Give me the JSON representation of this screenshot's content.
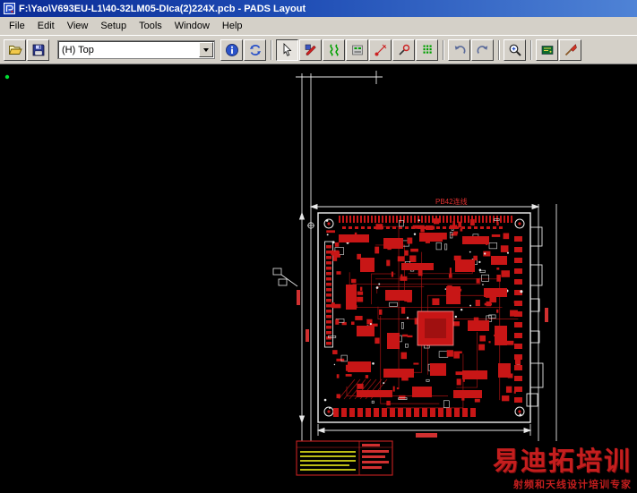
{
  "window": {
    "title": "F:\\Yao\\V693EU-L1\\40-32LM05-DIca(2)224X.pcb - PADS Layout"
  },
  "menu": {
    "items": [
      {
        "label": "File"
      },
      {
        "label": "Edit"
      },
      {
        "label": "View"
      },
      {
        "label": "Setup"
      },
      {
        "label": "Tools"
      },
      {
        "label": "Window"
      },
      {
        "label": "Help"
      }
    ]
  },
  "toolbar": {
    "layer_select": {
      "value": "(H) Top"
    },
    "buttons": [
      {
        "name": "open",
        "icon": "open-folder-icon"
      },
      {
        "name": "save",
        "icon": "floppy-disk-icon"
      },
      {
        "name": "object-info",
        "icon": "info-icon"
      },
      {
        "name": "redraw",
        "icon": "redraw-icon"
      },
      {
        "name": "selection-mode",
        "icon": "arrow-cursor-icon",
        "pressed": true
      },
      {
        "name": "design-toolbar",
        "icon": "design-icon"
      },
      {
        "name": "routing-toolbar",
        "icon": "routing-icon"
      },
      {
        "name": "eco-toolbar",
        "icon": "eco-icon"
      },
      {
        "name": "dimensioning-toolbar",
        "icon": "dimension-icon"
      },
      {
        "name": "drafting-toolbar",
        "icon": "drafting-icon"
      },
      {
        "name": "bga-toolbar",
        "icon": "bga-grid-icon"
      },
      {
        "name": "undo",
        "icon": "undo-arrow-icon"
      },
      {
        "name": "redo",
        "icon": "redo-arrow-icon"
      },
      {
        "name": "zoom",
        "icon": "magnifier-icon"
      },
      {
        "name": "board-view",
        "icon": "board-icon"
      },
      {
        "name": "cluster",
        "icon": "brush-icon"
      }
    ]
  },
  "canvas": {
    "net_label": "PB42连线",
    "watermark": {
      "line1": "易迪拓培训",
      "line2": "射频和天线设计培训专家"
    }
  },
  "colors": {
    "titlebar_left": "#0b2c96",
    "titlebar_right": "#4f83d6",
    "chrome": "#d4d0c8",
    "canvas_bg": "#000000",
    "pcb_red": "#c81616",
    "pcb_white": "#f0f0f0",
    "table_yellow": "#d8d818",
    "watermark_red": "#c41e1e"
  }
}
